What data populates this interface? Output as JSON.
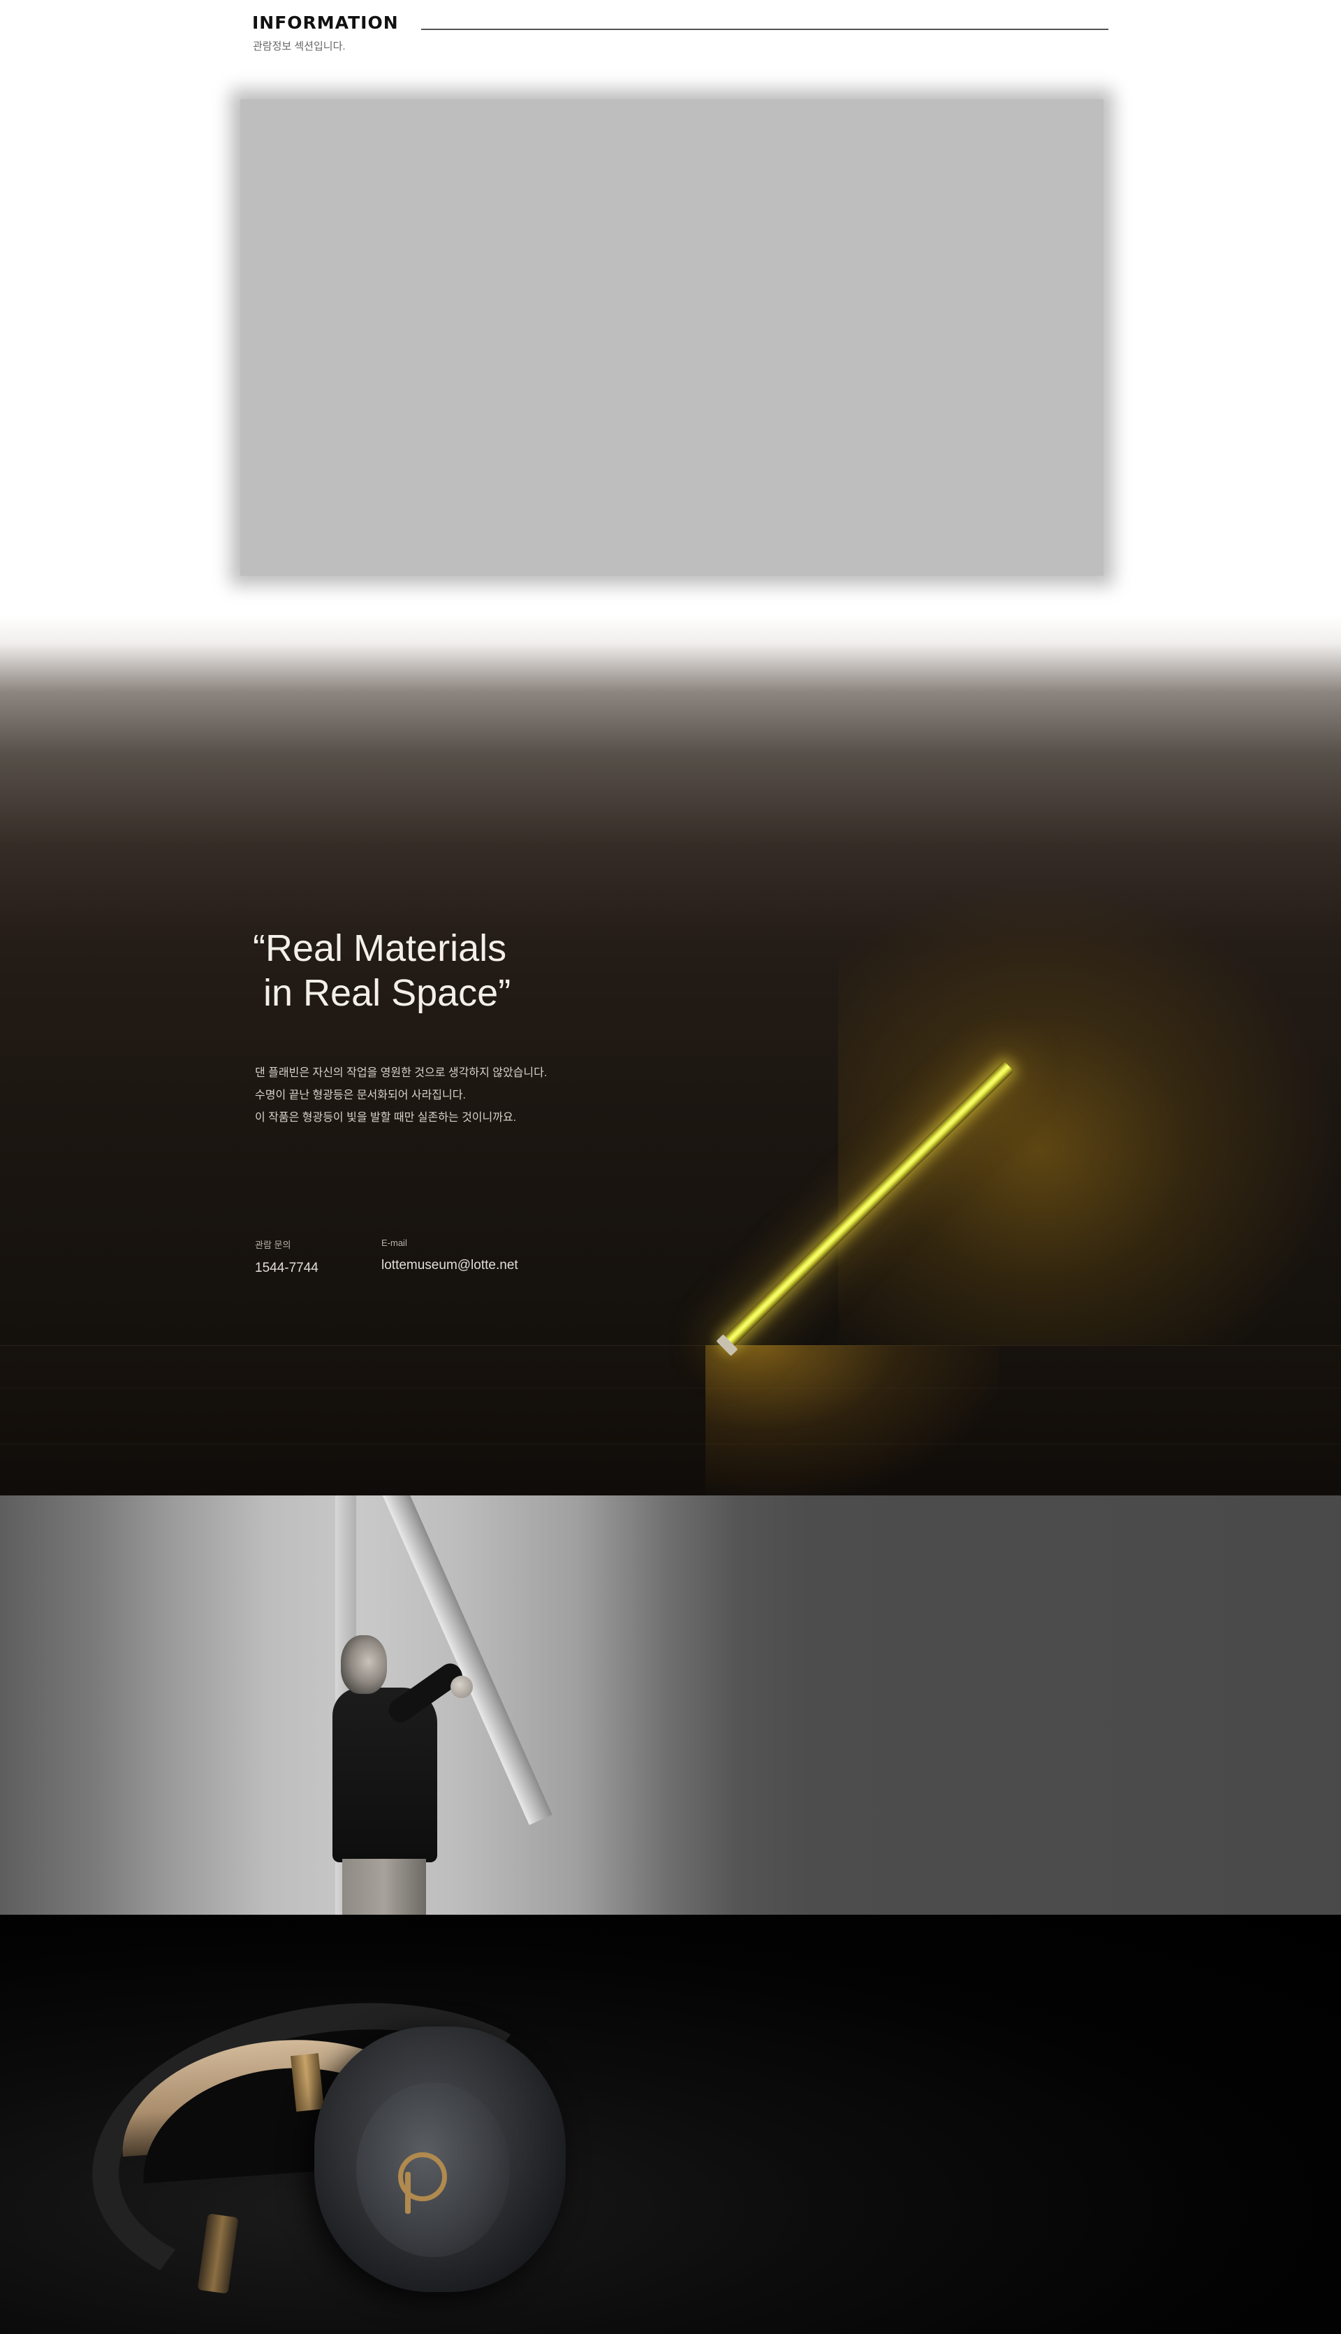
{
  "information": {
    "title": "INFORMATION",
    "subtitle": "관람정보 섹션입니다."
  },
  "hero": {
    "quote": "“Real Materials\n in Real Space”",
    "description": [
      "댄 플래빈은 자신의 작업을 영원한 것으로 생각하지 않았습니다.",
      "수명이 끝난 형광등은 문서화되어 사라집니다.",
      "이 작품은 형광등이 빛을 발할 때만 실존하는 것이니까요."
    ],
    "contact": {
      "phone_label": "관람 문의",
      "phone_value": "1544-7744",
      "email_label": "E-mail",
      "email_value": "lottemuseum@lotte.net"
    }
  },
  "colors": {
    "lamp": "#f0f25a",
    "hero_background": "#1d1712",
    "map_placeholder": "#bebebe"
  }
}
